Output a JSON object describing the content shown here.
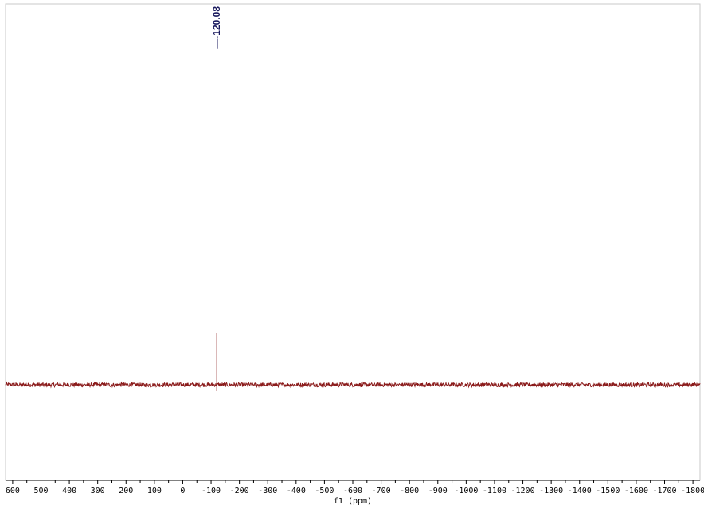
{
  "chart_data": {
    "type": "line",
    "title": "",
    "xlabel": "f1 (ppm)",
    "ylabel": "",
    "x_reversed": true,
    "xlim": [
      625,
      -1825
    ],
    "x_ticks": [
      600,
      500,
      400,
      300,
      200,
      100,
      0,
      -100,
      -200,
      -300,
      -400,
      -500,
      -600,
      -700,
      -800,
      -900,
      -1000,
      -1100,
      -1200,
      -1300,
      -1400,
      -1500,
      -1600,
      -1700,
      -1800
    ],
    "x_tick_labels": [
      "600",
      "500",
      "400",
      "300",
      "200",
      "100",
      "0",
      "-100",
      "-200",
      "-300",
      "-400",
      "-500",
      "-600",
      "-700",
      "-800",
      "-900",
      "-1000",
      "-1100",
      "-1200",
      "-1300",
      "-1400",
      "-1500",
      "-1600",
      "-1700",
      "-1800"
    ],
    "series": [
      {
        "color": "#8b1c1c",
        "baseline": 0,
        "noise_amplitude": 0.08,
        "peaks": [
          {
            "x": -120.08,
            "y": 1.0
          }
        ]
      }
    ],
    "annotations": [
      {
        "text": "—-120.08",
        "x": -120.08
      }
    ],
    "grid": false,
    "legend": "none"
  }
}
